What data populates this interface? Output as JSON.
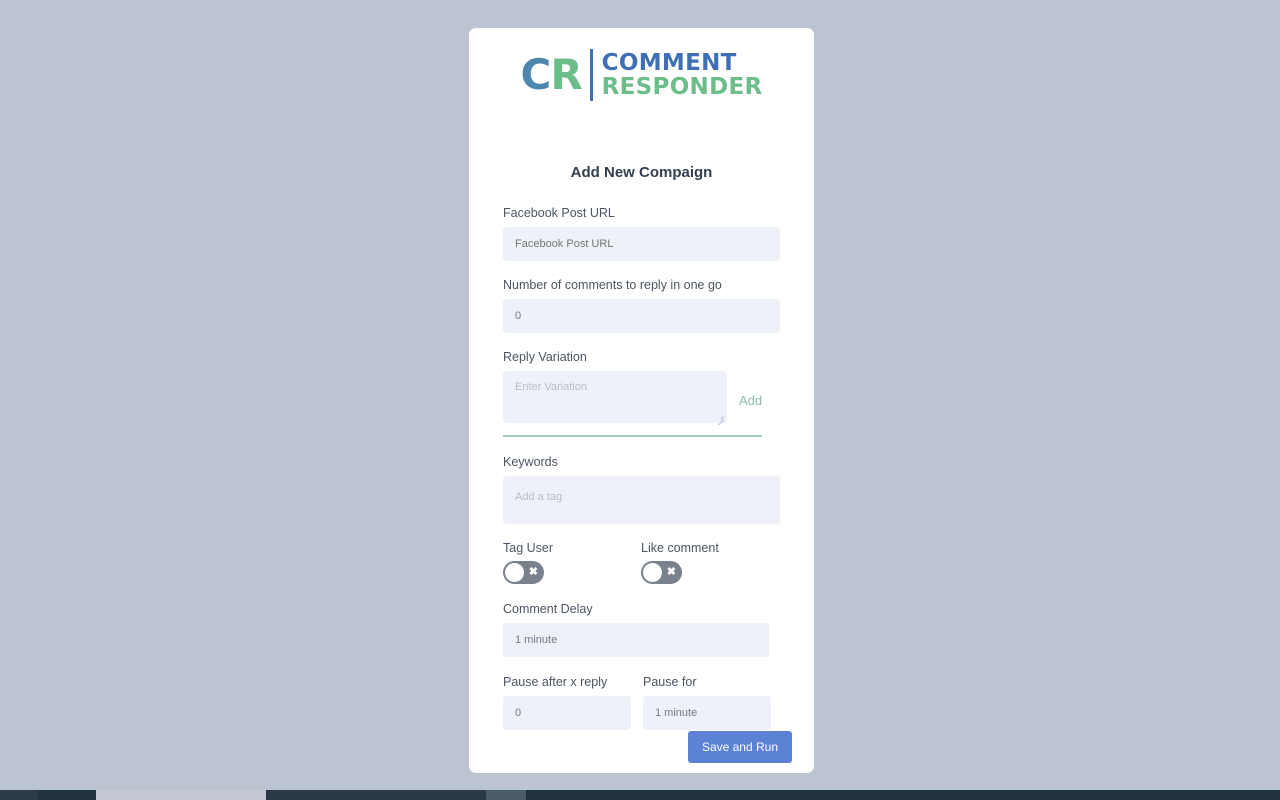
{
  "page": {
    "background_color": "#bcc3d1"
  },
  "logo": {
    "mark_c": "CR",
    "mark_c_letter": "C",
    "mark_r_letter": "R",
    "word_top": "COMMENT",
    "word_bottom": "RESPONDER",
    "color_blue": "#3f6fb5",
    "color_green": "#6dbd8b"
  },
  "card": {
    "title": "Add New Compaign"
  },
  "form": {
    "facebook_post_url": {
      "label": "Facebook Post URL",
      "placeholder": "Facebook Post URL",
      "value": ""
    },
    "number_of_comments": {
      "label": "Number of comments to reply in one go",
      "value": "0"
    },
    "reply_variation": {
      "label": "Reply Variation",
      "placeholder": "Enter Variation",
      "value": "",
      "add_label": "Add",
      "add_color": "#8fbca8",
      "divider_color": "#a7cfbe"
    },
    "keywords": {
      "label": "Keywords",
      "placeholder": "Add a tag",
      "value": ""
    },
    "tag_user": {
      "label": "Tag User",
      "state": "off",
      "icon": "cross-icon"
    },
    "like_comment": {
      "label": "Like comment",
      "state": "off",
      "icon": "cross-icon"
    },
    "comment_delay": {
      "label": "Comment Delay",
      "value": "1 minute"
    },
    "pause_after_x_reply": {
      "label": "Pause after x reply",
      "value": "0"
    },
    "pause_for": {
      "label": "Pause for",
      "value": "1 minute"
    }
  },
  "actions": {
    "save_and_run": "Save and Run",
    "save_button_color": "#5c82d6"
  }
}
